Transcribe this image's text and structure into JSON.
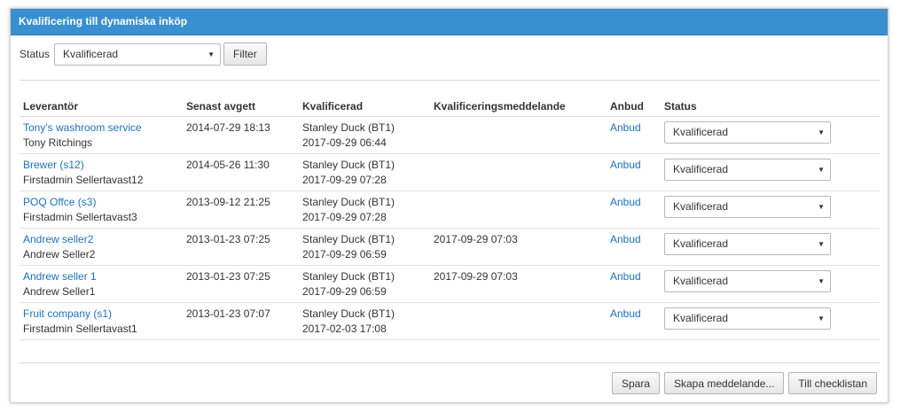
{
  "panel": {
    "title": "Kvalificering till dynamiska inköp"
  },
  "filter": {
    "status_label": "Status",
    "status_value": "Kvalificerad",
    "filter_button": "Filter"
  },
  "table": {
    "headers": [
      "Leverantör",
      "Senast avgett",
      "Kvalificerad",
      "Kvalificeringsmeddelande",
      "Anbud",
      "Status"
    ],
    "rows": [
      {
        "supplier": "Tony's washroom service",
        "contact": "Tony Ritchings",
        "submitted": "2014-07-29 18:13",
        "qualified_by": "Stanley Duck (BT1)",
        "qualified_at": "2017-09-29 06:44",
        "message": "",
        "bid": "Anbud",
        "status": "Kvalificerad"
      },
      {
        "supplier": "Brewer (s12)",
        "contact": "Firstadmin Sellertavast12",
        "submitted": "2014-05-26 11:30",
        "qualified_by": "Stanley Duck (BT1)",
        "qualified_at": "2017-09-29 07:28",
        "message": "",
        "bid": "Anbud",
        "status": "Kvalificerad"
      },
      {
        "supplier": "POQ Offce (s3)",
        "contact": "Firstadmin Sellertavast3",
        "submitted": "2013-09-12 21:25",
        "qualified_by": "Stanley Duck (BT1)",
        "qualified_at": "2017-09-29 07:28",
        "message": "",
        "bid": "Anbud",
        "status": "Kvalificerad"
      },
      {
        "supplier": "Andrew seller2",
        "contact": "Andrew Seller2",
        "submitted": "2013-01-23 07:25",
        "qualified_by": "Stanley Duck (BT1)",
        "qualified_at": "2017-09-29 06:59",
        "message": "2017-09-29 07:03",
        "bid": "Anbud",
        "status": "Kvalificerad"
      },
      {
        "supplier": "Andrew seller 1",
        "contact": "Andrew Seller1",
        "submitted": "2013-01-23 07:25",
        "qualified_by": "Stanley Duck (BT1)",
        "qualified_at": "2017-09-29 06:59",
        "message": "2017-09-29 07:03",
        "bid": "Anbud",
        "status": "Kvalificerad"
      },
      {
        "supplier": "Fruit company (s1)",
        "contact": "Firstadmin Sellertavast1",
        "submitted": "2013-01-23 07:07",
        "qualified_by": "Stanley Duck (BT1)",
        "qualified_at": "2017-02-03 17:08",
        "message": "",
        "bid": "Anbud",
        "status": "Kvalificerad"
      }
    ]
  },
  "footer": {
    "save": "Spara",
    "create_message": "Skapa meddelande...",
    "to_checklist": "Till checklistan"
  },
  "colors": {
    "header_bg": "#3a8fd1",
    "link": "#1a73c2"
  },
  "icons": {
    "dropdown": "chevron-down-icon"
  }
}
